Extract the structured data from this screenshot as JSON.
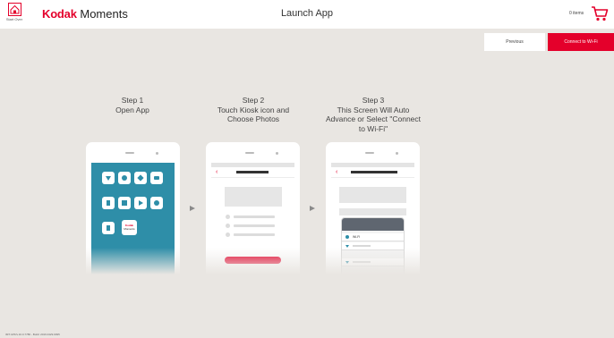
{
  "header": {
    "start_over_label": "Start Over",
    "start_over_icon": "home-icon",
    "brand": "Kodak",
    "product": "Moments",
    "title": "Launch App",
    "cart_count": "0 items",
    "cart_icon": "cart-icon",
    "accent_color": "#e4002b"
  },
  "actions": {
    "previous_label": "Previous",
    "connect_label": "Connect to Wi-Fi"
  },
  "steps": [
    {
      "heading": "Step 1",
      "lines": [
        "Open App"
      ]
    },
    {
      "heading": "Step 2",
      "lines": [
        "Touch Kiosk icon and",
        "Choose Photos"
      ]
    },
    {
      "heading": "Step 3",
      "lines": [
        "This Screen Will Auto",
        "Advance or Select \"Connect",
        "to Wi-Fi\""
      ]
    }
  ],
  "phone1": {
    "kiosk_app_line1": "Kodak",
    "kiosk_app_line2": "Moments",
    "screen_color": "#2e8ea8"
  },
  "phone3": {
    "wifi_option": "Wi-Fi"
  },
  "footer": {
    "build_info": "IMT APK/v.16.0.7786 - Build: 2016.0429.0095"
  }
}
